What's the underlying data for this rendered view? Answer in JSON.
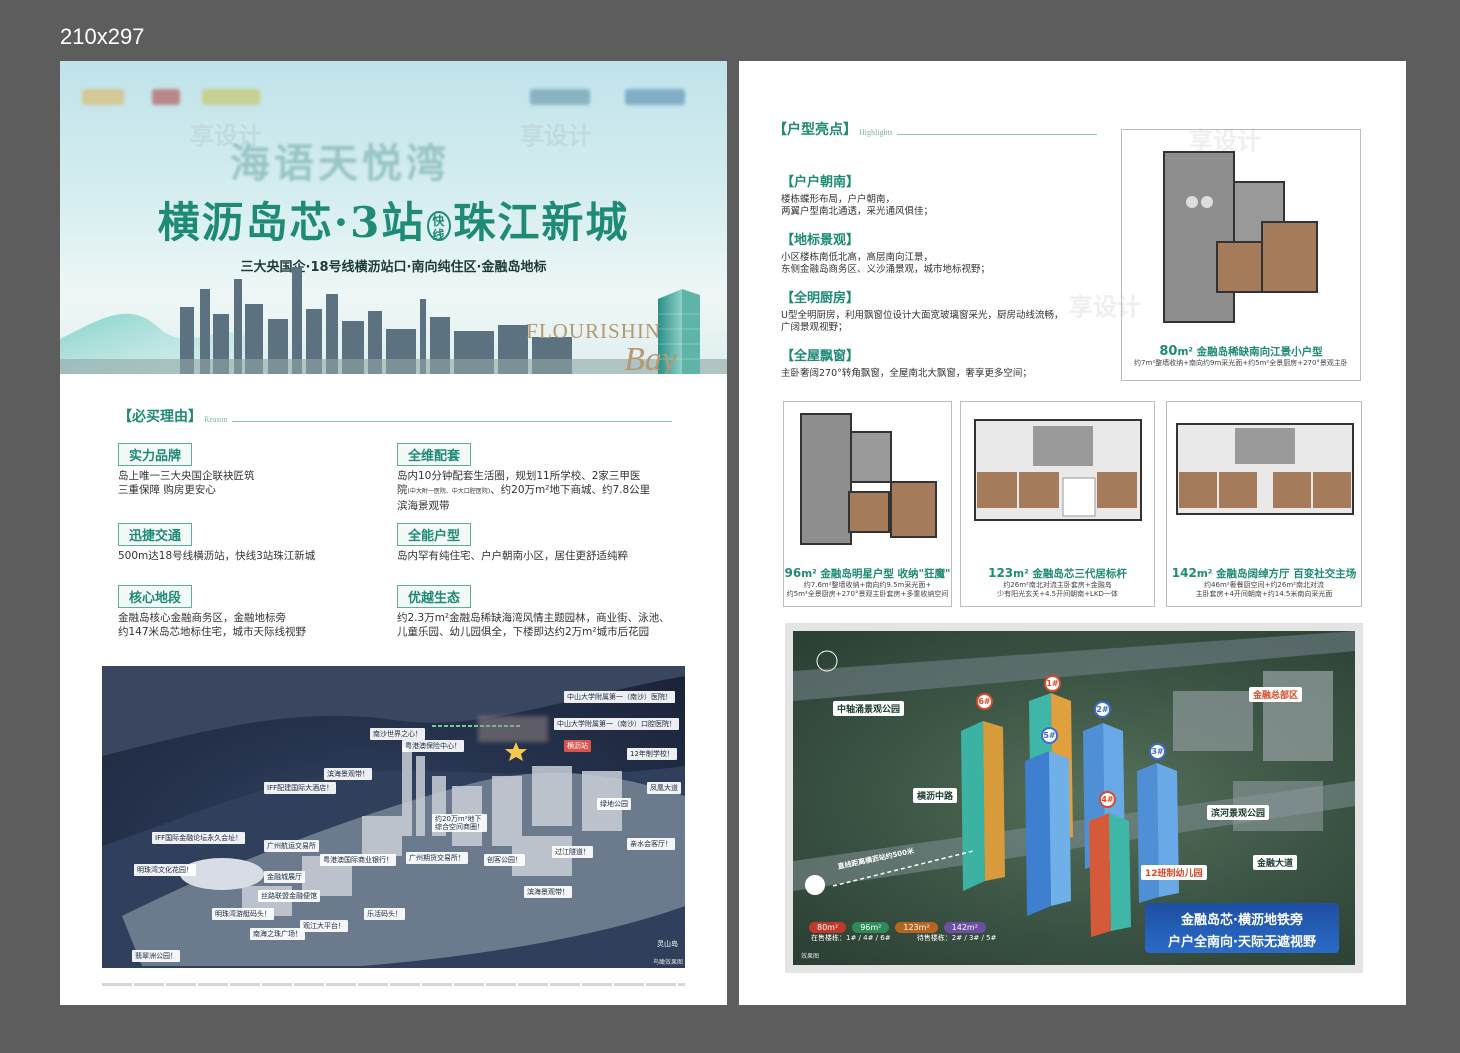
{
  "size_label": "210x297",
  "left": {
    "hero": {
      "brand": "海语天悦湾",
      "title_a": "横沥岛芯·3站",
      "title_tag": "快线",
      "title_b": "珠江新城",
      "subtitle": "三大央国企·18号线横沥站口·南向纯住区·金融岛地标",
      "en_1": "FLOURISHIN",
      "en_2": "Bay"
    },
    "reasons_heading": {
      "cn": "【必买理由】",
      "en": "Reason"
    },
    "reasons": [
      {
        "title": "实力品牌",
        "desc": "岛上唯一三大央国企联袂匠筑\n三重保障 购房更安心"
      },
      {
        "title": "全维配套",
        "desc_1": "岛内10分钟配套生活圈，规划11所学校、2家三甲医",
        "desc_2a": "院",
        "desc_2s": "(中大附一医院、中大口腔医院)",
        "desc_2b": "、约20万m²地下商城、约7.8公里",
        "desc_3": "滨海景观带"
      },
      {
        "title": "迅捷交通",
        "desc": "500m达18号线横沥站，快线3站珠江新城"
      },
      {
        "title": "全能户型",
        "desc": "岛内罕有纯住宅、户户朝南小区，居住更舒适纯粹"
      },
      {
        "title": "核心地段",
        "desc": "金融岛核心金融商务区，金融地标旁\n约147米岛芯地标住宅，城市天际线视野"
      },
      {
        "title": "优越生态",
        "desc": "约2.3万m²金融岛稀缺海湾风情主题园林，商业街、泳池、\n儿童乐园、幼儿园俱全，下楼即达约2万m²城市后花园"
      }
    ],
    "map_labels": [
      "中山大学附属第一（南沙）医院！",
      "中山大学附属第一（南沙）口腔医院！",
      "南沙世界之心！",
      "粤港澳保险中心！",
      "横沥站",
      "12年制学校！",
      "滨海景观带！",
      "凤凰大道",
      "IFF配建国际大酒店！",
      "绿地公园",
      "约20万m²地下\n综合空间商圈！",
      "IFF国际金融论坛永久会址！",
      "广州航运交易所",
      "粤港澳国际商业银行！",
      "广州期货交易所！",
      "创客公园！",
      "亲水会客厅！",
      "过江隧道！",
      "明珠湾文化花园！",
      "金融城展厅",
      "丝路联盟金融便馆",
      "明珠湾游艇码头！",
      "观江大平台！",
      "乐活码头！",
      "南海之珠广场！",
      "滨海景观带！",
      "翡翠洲公园！",
      "灵山岛",
      "鸟瞰效果图"
    ]
  },
  "right": {
    "hl_heading": {
      "cn": "【户型亮点】",
      "en": "Highlights"
    },
    "highlights": [
      {
        "title": "【户户朝南】",
        "desc": "楼栋蝶形布局，户户朝南，\n两翼户型南北通透，采光通风俱佳；"
      },
      {
        "title": "【地标景观】",
        "desc": "小区楼栋南低北高，高层南向江景，\n东侧金融岛商务区、义沙涌景观，城市地标视野；"
      },
      {
        "title": "【全明厨房】",
        "desc": "U型全明厨房，利用飘窗位设计大面宽玻璃窗采光，厨房动线流畅，\n广阔景观视野；"
      },
      {
        "title": "【全屋飘窗】",
        "desc": "主卧奢阔270°转角飘窗，全屋南北大飘窗，奢享更多空间；"
      }
    ],
    "plans": [
      {
        "main_a": "80",
        "main_b": "m² 金融岛稀缺南向江景小户型",
        "sub": "约7m²整墙收纳+南向约9m采光面+约5m²全景厨房+270°景观主卧"
      },
      {
        "main_a": "96",
        "main_b": "m² 金融岛明星户型 收纳\"狂魔\"",
        "sub": "约7.6m²整墙收纳+南向约9.5m采光面+\n约5m²全景厨房+270°景观主卧套房+多重收纳空间"
      },
      {
        "main_a": "123",
        "main_b": "m² 金融岛芯三代居标杆",
        "sub": "约26m²南北对流主卧套房+金融岛\n少有阳光玄关+4.5开间朝南+LKD一体"
      },
      {
        "main_a": "142",
        "main_b": "m² 金融岛阔绰方厅 百变社交主场",
        "sub": "约46m²奢餐厨空间+约26m²南北对流\n主卧套房+4开间朝南+约14.5米南向采光面"
      }
    ],
    "render": {
      "labels": [
        "中轴涌景观公园",
        "横沥中路",
        "金融总部区",
        "滨河景观公园",
        "金融大道",
        "12班制幼儿园",
        "直线距离横沥站约500米"
      ],
      "towers": [
        "6#",
        "1#",
        "2#",
        "5#",
        "3#",
        "4#"
      ],
      "chips": [
        "80m²",
        "96m²",
        "123m²",
        "142m²"
      ],
      "chip_colors": [
        "#c0392b",
        "#2e8b57",
        "#b5651d",
        "#6a4fa3"
      ],
      "on_sale": "在售楼栋：1# / 4# / 6#",
      "coming": "待售楼栋：2# / 3# / 5#",
      "banner_1": "金融岛芯·横沥地铁旁",
      "banner_2": "户户全南向·天际无遮视野",
      "caption": "效果图"
    }
  }
}
